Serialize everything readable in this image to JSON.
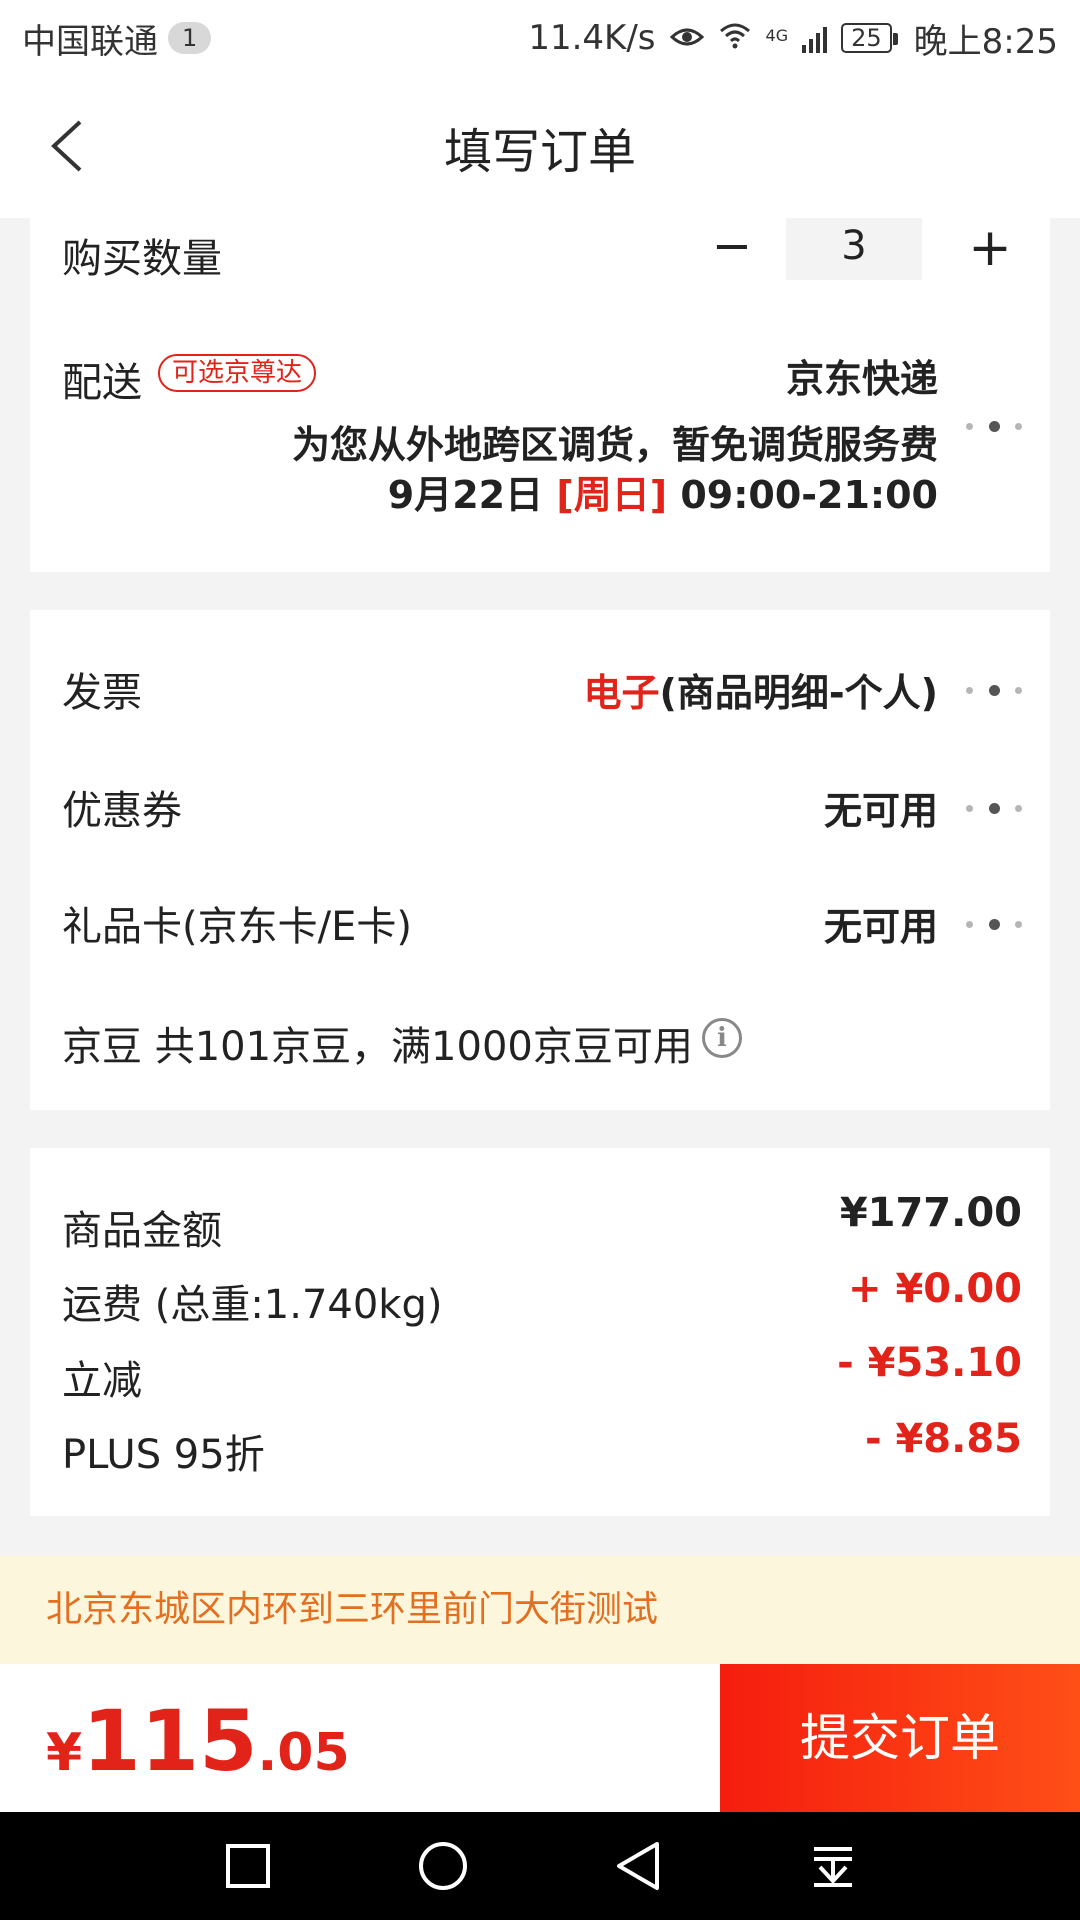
{
  "status_bar": {
    "carrier": "中国联通",
    "notification_count": "1",
    "speed": "11.4K/s",
    "network": "4G",
    "battery": "25",
    "time": "晚上8:25"
  },
  "header": {
    "title": "填写订单"
  },
  "quantity": {
    "label": "购买数量",
    "minus": "−",
    "value": "3",
    "plus": "+"
  },
  "shipping": {
    "label": "配送",
    "tag": "可选京尊达",
    "value": "京东快递",
    "note": "为您从外地跨区调货，暂免调货服务费",
    "date": "9月22日",
    "weekday": "[周日]",
    "time_range": "09:00-21:00"
  },
  "invoice": {
    "label": "发票",
    "value_red": "电子",
    "value_rest": "(商品明细-个人)"
  },
  "coupon": {
    "label": "优惠券",
    "value": "无可用"
  },
  "giftcard": {
    "label": "礼品卡(京东卡/E卡)",
    "value": "无可用"
  },
  "jingdou": {
    "text": "京豆 共101京豆，满1000京豆可用",
    "info": "i"
  },
  "summary": {
    "items": [
      {
        "label": "商品金额",
        "value": "¥177.00"
      },
      {
        "label": "运费 (总重:1.740kg)",
        "value": "+ ¥0.00"
      },
      {
        "label": "立减",
        "value": "- ¥53.10"
      },
      {
        "label": "PLUS 95折",
        "value": "- ¥8.85"
      }
    ]
  },
  "address": {
    "text": "北京东城区内环到三环里前门大街测试"
  },
  "footer": {
    "currency": "¥",
    "total_int": "115",
    "total_dec": ".05",
    "submit_label": "提交订单"
  },
  "colors": {
    "accent_red": "#e2231a",
    "address_bg": "#fcf6dd",
    "address_text": "#e36f20"
  }
}
